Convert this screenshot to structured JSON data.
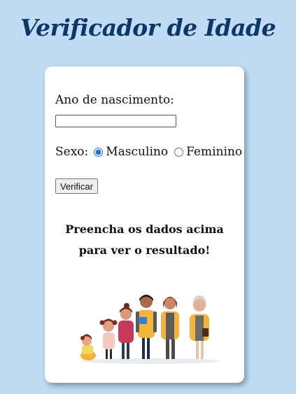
{
  "header": {
    "title": "Verificador de Idade"
  },
  "form": {
    "birth_year_label": "Ano de nascimento:",
    "birth_year_value": "",
    "birth_year_placeholder": "",
    "sex_label": "Sexo:",
    "sex_options": [
      "Masculino",
      "Feminino"
    ],
    "sex_selected": "Masculino",
    "submit_label": "Verificar"
  },
  "result": {
    "message": "Preencha os dados acima para ver o resultado!"
  },
  "image": {
    "icon": "family-generations-illustration"
  },
  "colors": {
    "background": "#bfdcf4",
    "title": "#0d3768",
    "card": "#ffffff",
    "radio_accent": "#1a73e8"
  }
}
